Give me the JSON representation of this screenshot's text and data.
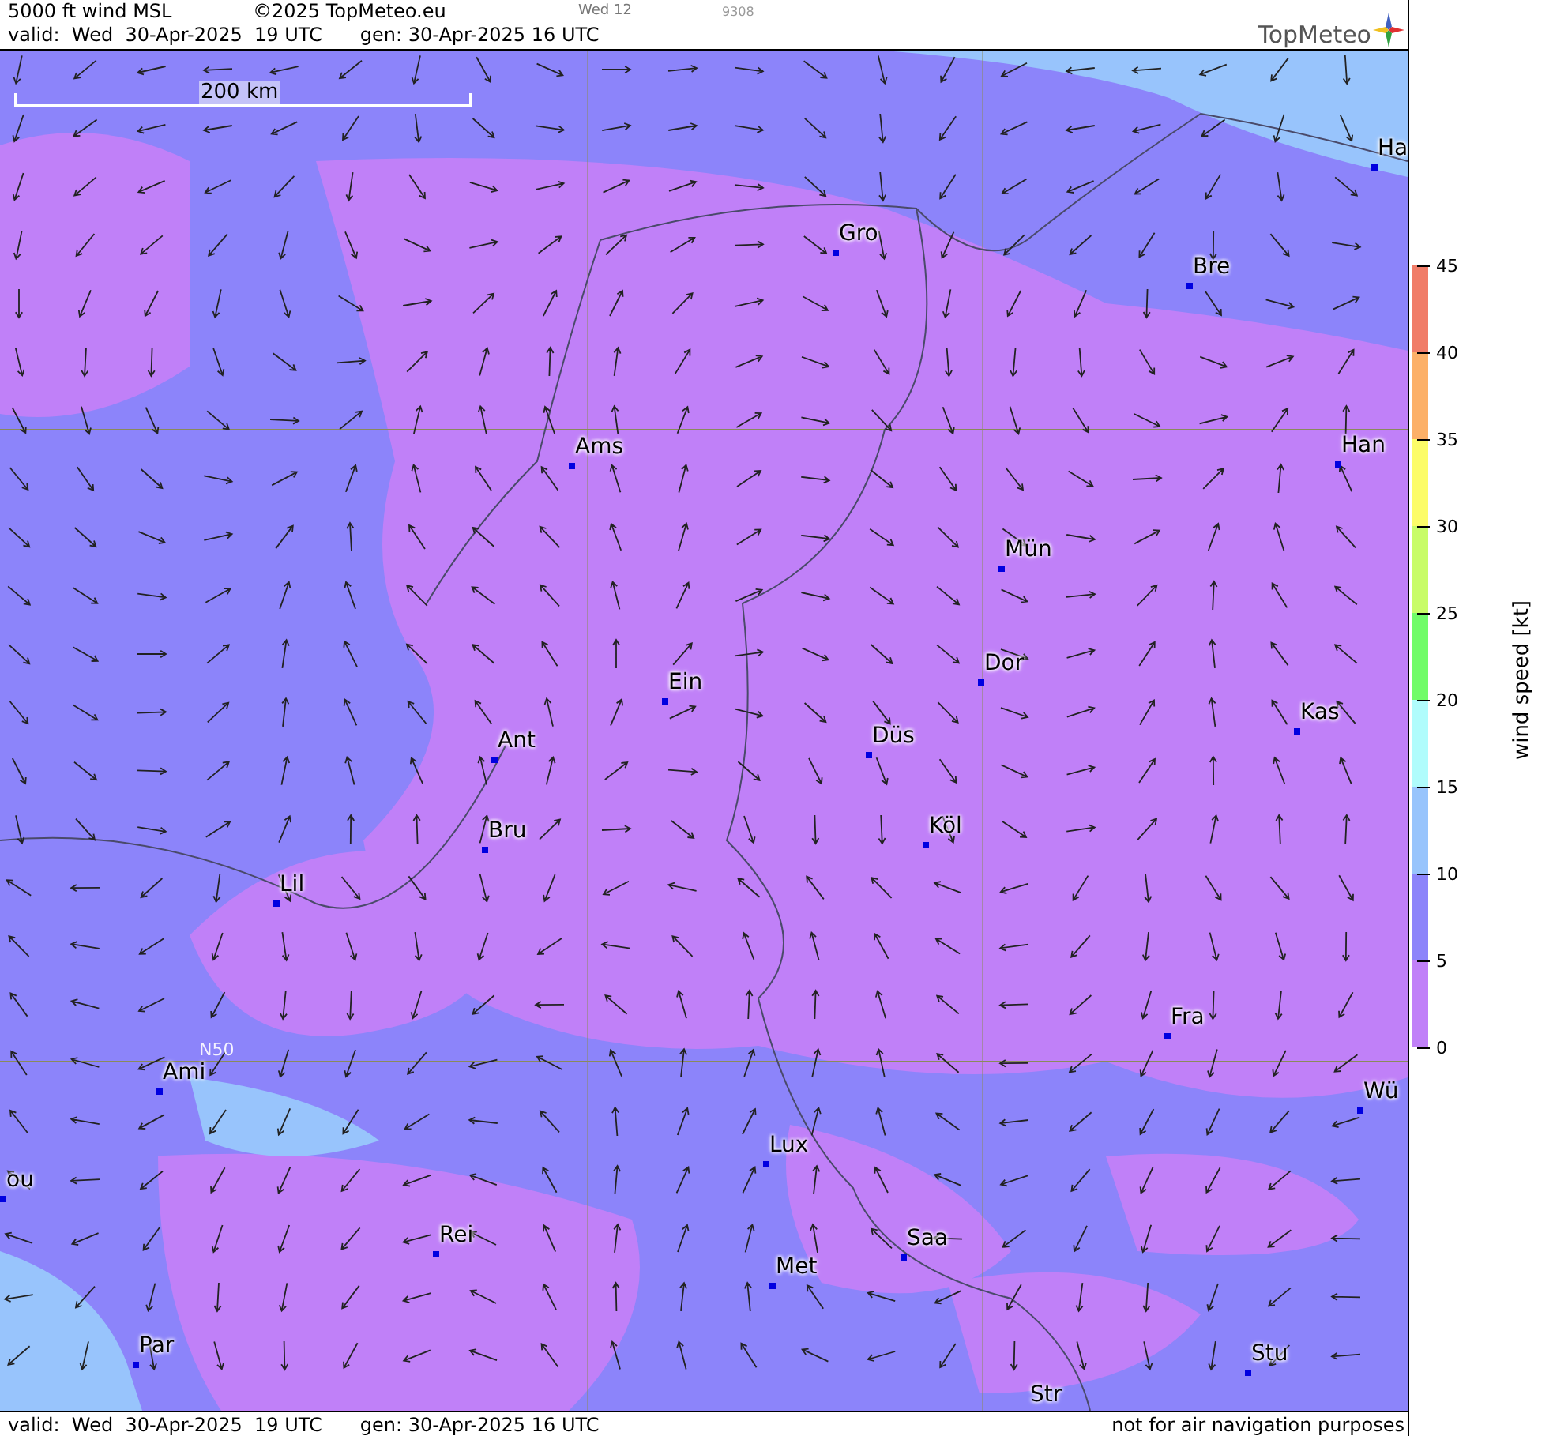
{
  "header": {
    "title": "5000 ft wind MSL",
    "copyright": "©2025 TopMeteo.eu",
    "day_label": "Wed 12",
    "code": "9308",
    "valid": "valid:  Wed  30-Apr-2025  19 UTC",
    "generated": "gen: 30-Apr-2025 16 UTC",
    "logo": "TopMeteo"
  },
  "map": {
    "scale_label": "200 km",
    "latitude_label": "N50",
    "cities": [
      {
        "name": "Ha"
      },
      {
        "name": "Gro"
      },
      {
        "name": "Bre"
      },
      {
        "name": "Ams"
      },
      {
        "name": "Han"
      },
      {
        "name": "Mün"
      },
      {
        "name": "Dor"
      },
      {
        "name": "Ein"
      },
      {
        "name": "Kas"
      },
      {
        "name": "Düs"
      },
      {
        "name": "Ant"
      },
      {
        "name": "Köl"
      },
      {
        "name": "Bru"
      },
      {
        "name": "Lil"
      },
      {
        "name": "Fra"
      },
      {
        "name": "Ami"
      },
      {
        "name": "Wü"
      },
      {
        "name": "Lux"
      },
      {
        "name": "ou"
      },
      {
        "name": "Rei"
      },
      {
        "name": "Saa"
      },
      {
        "name": "Met"
      },
      {
        "name": "Par"
      },
      {
        "name": "Stu"
      },
      {
        "name": "Str"
      }
    ]
  },
  "legend": {
    "title": "wind speed [kt]",
    "ticks": [
      "45",
      "40",
      "35",
      "30",
      "25",
      "20",
      "15",
      "10",
      "5",
      "0"
    ],
    "bands": [
      {
        "color": "#f07c68"
      },
      {
        "color": "#fcb068"
      },
      {
        "color": "#fcfc68"
      },
      {
        "color": "#c8fc68"
      },
      {
        "color": "#70fc68"
      },
      {
        "color": "#b0fcfc"
      },
      {
        "color": "#98c4fc"
      },
      {
        "color": "#8c84fa"
      },
      {
        "color": "#c080f8"
      }
    ]
  },
  "footer": {
    "valid": "valid:  Wed  30-Apr-2025  19 UTC",
    "generated": "gen: 30-Apr-2025 16 UTC",
    "disclaimer": "not for air navigation purposes"
  }
}
